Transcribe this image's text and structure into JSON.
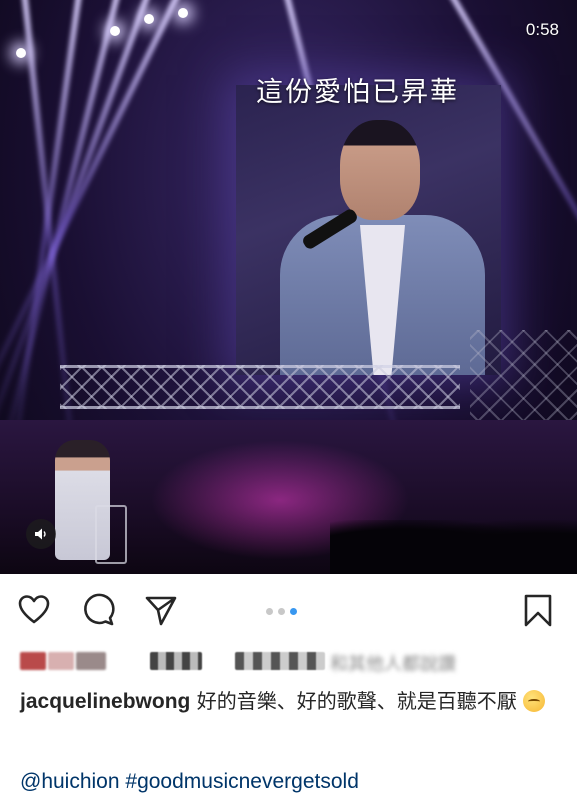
{
  "media": {
    "lyric_overlay": "這份愛怕已昇華",
    "time_remaining": "0:58",
    "mute_icon": "speaker-icon",
    "carousel": {
      "total": 3,
      "active_index": 2
    }
  },
  "actions": {
    "like_icon": "heart-icon",
    "comment_icon": "comment-icon",
    "share_icon": "paper-plane-icon",
    "save_icon": "bookmark-icon"
  },
  "likes": {
    "text": "和其他人都說讚"
  },
  "caption": {
    "username": "jacquelinebwong",
    "text": " 好的音樂、好的歌聲、就是百聽不厭",
    "emoji": "relieved-face-emoji"
  },
  "tags": {
    "mention": "@huichion",
    "hashtag": "#goodmusicnevergetsold"
  },
  "colors": {
    "accent_blue": "#3897f0",
    "link_blue": "#003569",
    "text": "#262626",
    "dot_inactive": "#c8c8c8"
  }
}
